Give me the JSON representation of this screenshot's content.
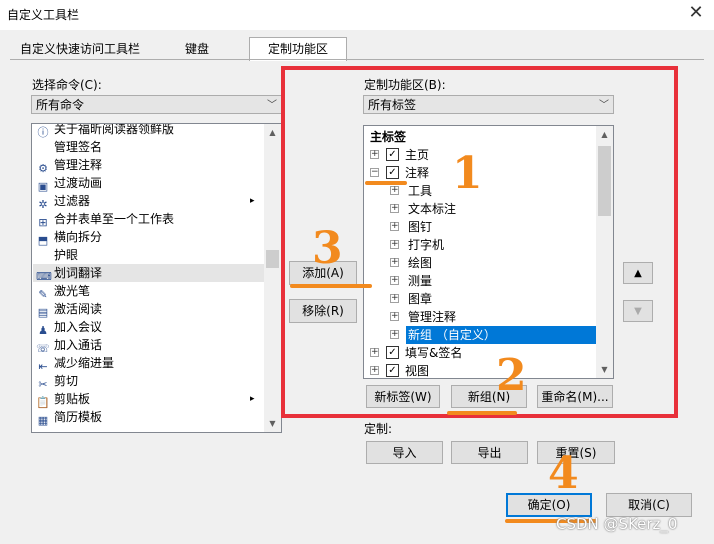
{
  "window": {
    "title": "自定义工具栏",
    "close_glyph": "✕"
  },
  "tabs": [
    {
      "label": "自定义快速访问工具栏"
    },
    {
      "label": "键盘"
    },
    {
      "label": "定制功能区"
    }
  ],
  "left": {
    "choose_label": "选择命令(C):",
    "choose_value": "所有命令",
    "commands": [
      {
        "label": "关于福昕阅读器领鲜版",
        "icon": "info-icon"
      },
      {
        "label": "管理签名",
        "icon": ""
      },
      {
        "label": "管理注释",
        "icon": "settings-icon"
      },
      {
        "label": "过渡动画",
        "icon": "transition-icon"
      },
      {
        "label": "过滤器",
        "icon": "filter-icon",
        "submenu": true
      },
      {
        "label": "合并表单至一个工作表",
        "icon": "merge-icon"
      },
      {
        "label": "横向拆分",
        "icon": "split-icon"
      },
      {
        "label": "护眼",
        "icon": ""
      },
      {
        "label": "划词翻译",
        "icon": "translate-icon",
        "selected": true
      },
      {
        "label": "激光笔",
        "icon": "laser-pen-icon"
      },
      {
        "label": "激活阅读",
        "icon": "activate-read-icon"
      },
      {
        "label": "加入会议",
        "icon": "join-meeting-icon"
      },
      {
        "label": "加入通话",
        "icon": "join-call-icon"
      },
      {
        "label": "减少缩进量",
        "icon": "outdent-icon"
      },
      {
        "label": "剪切",
        "icon": "scissors-icon"
      },
      {
        "label": "剪贴板",
        "icon": "clipboard-icon",
        "submenu": true
      },
      {
        "label": "简历模板",
        "icon": "template-icon"
      }
    ]
  },
  "middle": {
    "add_label": "添加(A)",
    "remove_label": "移除(R)"
  },
  "right": {
    "customize_label": "定制功能区(B):",
    "customize_value": "所有标签",
    "tree_header": "主标签",
    "tree": [
      {
        "label": "主页",
        "level": 0,
        "expander": "+",
        "checked": true
      },
      {
        "label": "注释",
        "level": 0,
        "expander": "−",
        "checked": true
      },
      {
        "label": "工具",
        "level": 1,
        "expander": "+"
      },
      {
        "label": "文本标注",
        "level": 1,
        "expander": "+"
      },
      {
        "label": "图钉",
        "level": 1,
        "expander": "+"
      },
      {
        "label": "打字机",
        "level": 1,
        "expander": "+"
      },
      {
        "label": "绘图",
        "level": 1,
        "expander": "+"
      },
      {
        "label": "测量",
        "level": 1,
        "expander": "+"
      },
      {
        "label": "图章",
        "level": 1,
        "expander": "+"
      },
      {
        "label": "管理注释",
        "level": 1,
        "expander": "+"
      },
      {
        "label": "新组 （自定义）",
        "level": 1,
        "expander": "+",
        "highlight": true
      },
      {
        "label": "填写&签名",
        "level": 0,
        "expander": "+",
        "checked": true
      },
      {
        "label": "视图",
        "level": 0,
        "expander": "+",
        "checked": true
      }
    ],
    "new_tab_label": "新标签(W)",
    "new_group_label": "新组(N)",
    "rename_label": "重命名(M)...",
    "customize2_label": "定制:",
    "import_label": "导入",
    "export_label": "导出",
    "reset_label": "重置(S)",
    "up_glyph": "▲",
    "down_glyph": "▼"
  },
  "footer": {
    "ok_label": "确定(O)",
    "cancel_label": "取消(C)"
  },
  "annotations": [
    "1",
    "2",
    "3",
    "4"
  ],
  "watermark": "CSDN @SKerz_0",
  "colors": {
    "annotation_box": "#e8303a",
    "annotation_ink": "#f28a1e",
    "selection": "#0078d7"
  }
}
